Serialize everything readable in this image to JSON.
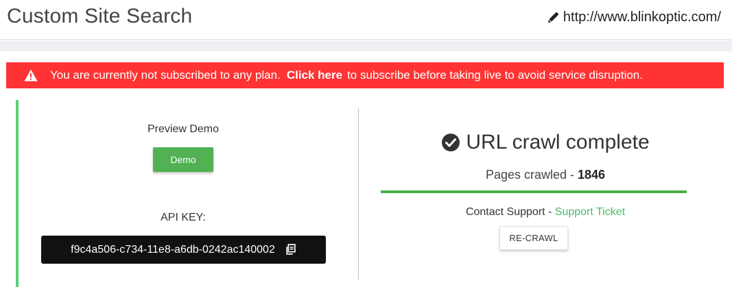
{
  "header": {
    "title": "Custom Site Search",
    "site_url": "http://www.blinkoptic.com/",
    "edit_icon": "pencil-icon"
  },
  "alert": {
    "icon": "warning-icon",
    "text_before": "You are currently not subscribed to any plan.",
    "link_text": "Click here",
    "text_after": "to subscribe before taking live to avoid service disruption.",
    "background_color": "#ff3333"
  },
  "preview": {
    "label": "Preview Demo",
    "button_label": "Demo",
    "button_color": "#52b152"
  },
  "api": {
    "label": "API KEY:",
    "key": "f9c4a506-c734-11e8-a6db-0242ac140002",
    "copy_icon": "copy-icon"
  },
  "crawl": {
    "status_icon": "check-circle-icon",
    "status_text": "URL crawl complete",
    "pages_label": "Pages crawled - ",
    "pages_count": "1846",
    "progress_percent": 100,
    "progress_color": "#4cae4c",
    "contact_label": "Contact Support - ",
    "support_link": "Support Ticket",
    "support_link_color": "#4cbb67",
    "recrawl_label": "RE-CRAWL"
  },
  "accent_color": "#5cd175"
}
